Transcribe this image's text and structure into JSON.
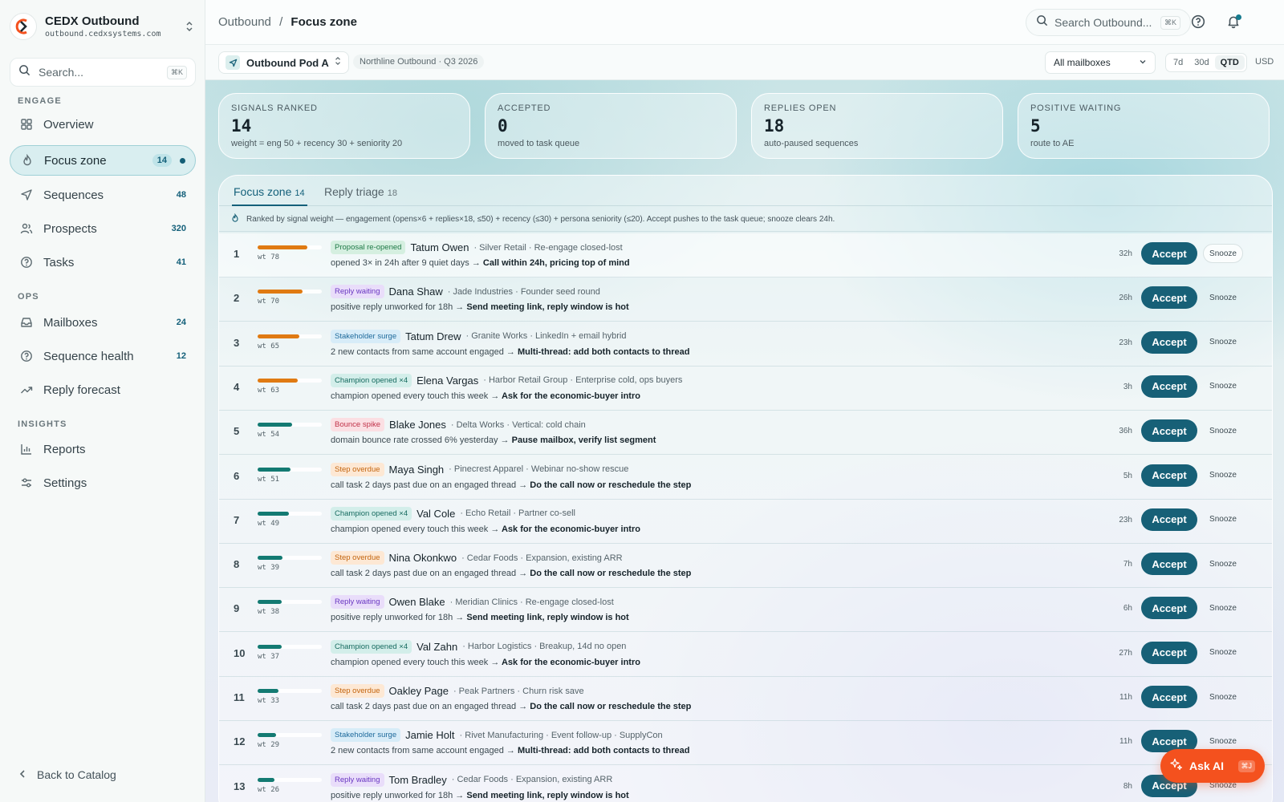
{
  "brand": {
    "name": "CEDX Outbound",
    "domain": "outbound.cedxsystems.com"
  },
  "sidebar": {
    "search_placeholder": "Search...",
    "search_kbd": "⌘K",
    "sections": {
      "engage": "ENGAGE",
      "ops": "OPS",
      "insights": "INSIGHTS"
    },
    "items": [
      {
        "label": "Overview",
        "count": "",
        "icon": "grid-icon"
      },
      {
        "label": "Focus zone",
        "count": "14",
        "icon": "flame-icon"
      },
      {
        "label": "Sequences",
        "count": "48",
        "icon": "send-icon"
      },
      {
        "label": "Prospects",
        "count": "320",
        "icon": "users-icon"
      },
      {
        "label": "Tasks",
        "count": "41",
        "icon": "help-circle-icon"
      },
      {
        "label": "Mailboxes",
        "count": "24",
        "icon": "inbox-icon"
      },
      {
        "label": "Sequence health",
        "count": "12",
        "icon": "help-circle-icon"
      },
      {
        "label": "Reply forecast",
        "count": "",
        "icon": "trending-up-icon"
      },
      {
        "label": "Reports",
        "count": "",
        "icon": "bar-chart-icon"
      },
      {
        "label": "Settings",
        "count": "",
        "icon": "sliders-icon"
      }
    ],
    "back": "Back to Catalog"
  },
  "topbar": {
    "crumb_root": "Outbound",
    "crumb_sep": "/",
    "crumb_current": "Focus zone",
    "search_placeholder": "Search Outbound...",
    "search_kbd": "⌘K"
  },
  "subbar": {
    "pod": "Outbound Pod A",
    "pod_meta": "Northline Outbound · Q3 2026",
    "mailbox": "All mailboxes",
    "ranges": [
      "7d",
      "30d",
      "QTD"
    ],
    "active_range": "QTD",
    "currency": "USD"
  },
  "stats": [
    {
      "label": "SIGNALS RANKED",
      "value": "14",
      "desc": "weight = eng 50 + recency 30 + seniority 20"
    },
    {
      "label": "ACCEPTED",
      "value": "0",
      "desc": "moved to task queue"
    },
    {
      "label": "REPLIES OPEN",
      "value": "18",
      "desc": "auto-paused sequences"
    },
    {
      "label": "POSITIVE WAITING",
      "value": "5",
      "desc": "route to AE"
    }
  ],
  "tabs": [
    {
      "label": "Focus zone",
      "count": "14"
    },
    {
      "label": "Reply triage",
      "count": "18"
    }
  ],
  "hint": "Ranked by signal weight — engagement (opens×6 + replies×18, ≤50) + recency (≤30) + persona seniority (≤20). Accept pushes to the task queue; snooze clears 24h.",
  "actions": {
    "accept": "Accept",
    "snooze": "Snooze"
  },
  "colors": {
    "accent": "#176077",
    "weight_high": "#e07a12",
    "weight_low": "#137a72",
    "ask_ai": "#f4511e"
  },
  "rows": [
    {
      "rank": "1",
      "weight": 78,
      "wt": "wt 78",
      "tag": "Proposal re-opened",
      "tag_color": "green",
      "person": "Tatum Owen",
      "meta": "· Silver Retail · Re-engage closed-lost",
      "signal": "opened 3× in 24h after 9 quiet days →",
      "action": " Call within 24h, pricing top of mind",
      "age": "32h"
    },
    {
      "rank": "2",
      "weight": 70,
      "wt": "wt 70",
      "tag": "Reply waiting",
      "tag_color": "purple",
      "person": "Dana Shaw",
      "meta": "· Jade Industries · Founder seed round",
      "signal": "positive reply unworked for 18h →",
      "action": " Send meeting link, reply window is hot",
      "age": "26h"
    },
    {
      "rank": "3",
      "weight": 65,
      "wt": "wt 65",
      "tag": "Stakeholder surge",
      "tag_color": "blue",
      "person": "Tatum Drew",
      "meta": "· Granite Works · LinkedIn + email hybrid",
      "signal": "2 new contacts from same account engaged →",
      "action": " Multi-thread: add both contacts to thread",
      "age": "23h"
    },
    {
      "rank": "4",
      "weight": 63,
      "wt": "wt 63",
      "tag": "Champion opened ×4",
      "tag_color": "teal",
      "person": "Elena Vargas",
      "meta": "· Harbor Retail Group · Enterprise cold, ops buyers",
      "signal": "champion opened every touch this week →",
      "action": " Ask for the economic-buyer intro",
      "age": "3h"
    },
    {
      "rank": "5",
      "weight": 54,
      "wt": "wt 54",
      "tag": "Bounce spike",
      "tag_color": "red",
      "person": "Blake Jones",
      "meta": "· Delta Works · Vertical: cold chain",
      "signal": "domain bounce rate crossed 6% yesterday →",
      "action": " Pause mailbox, verify list segment",
      "age": "36h"
    },
    {
      "rank": "6",
      "weight": 51,
      "wt": "wt 51",
      "tag": "Step overdue",
      "tag_color": "orange",
      "person": "Maya Singh",
      "meta": "· Pinecrest Apparel · Webinar no-show rescue",
      "signal": "call task 2 days past due on an engaged thread →",
      "action": " Do the call now or reschedule the step",
      "age": "5h"
    },
    {
      "rank": "7",
      "weight": 49,
      "wt": "wt 49",
      "tag": "Champion opened ×4",
      "tag_color": "teal",
      "person": "Val Cole",
      "meta": "· Echo Retail · Partner co-sell",
      "signal": "champion opened every touch this week →",
      "action": " Ask for the economic-buyer intro",
      "age": "23h"
    },
    {
      "rank": "8",
      "weight": 39,
      "wt": "wt 39",
      "tag": "Step overdue",
      "tag_color": "orange",
      "person": "Nina Okonkwo",
      "meta": "· Cedar Foods · Expansion, existing ARR",
      "signal": "call task 2 days past due on an engaged thread →",
      "action": " Do the call now or reschedule the step",
      "age": "7h"
    },
    {
      "rank": "9",
      "weight": 38,
      "wt": "wt 38",
      "tag": "Reply waiting",
      "tag_color": "purple",
      "person": "Owen Blake",
      "meta": "· Meridian Clinics · Re-engage closed-lost",
      "signal": "positive reply unworked for 18h →",
      "action": " Send meeting link, reply window is hot",
      "age": "6h"
    },
    {
      "rank": "10",
      "weight": 37,
      "wt": "wt 37",
      "tag": "Champion opened ×4",
      "tag_color": "teal",
      "person": "Val Zahn",
      "meta": "· Harbor Logistics · Breakup, 14d no open",
      "signal": "champion opened every touch this week →",
      "action": " Ask for the economic-buyer intro",
      "age": "27h"
    },
    {
      "rank": "11",
      "weight": 33,
      "wt": "wt 33",
      "tag": "Step overdue",
      "tag_color": "orange",
      "person": "Oakley Page",
      "meta": "· Peak Partners · Churn risk save",
      "signal": "call task 2 days past due on an engaged thread →",
      "action": " Do the call now or reschedule the step",
      "age": "11h"
    },
    {
      "rank": "12",
      "weight": 29,
      "wt": "wt 29",
      "tag": "Stakeholder surge",
      "tag_color": "blue",
      "person": "Jamie Holt",
      "meta": "· Rivet Manufacturing · Event follow-up · SupplyCon",
      "signal": "2 new contacts from same account engaged →",
      "action": " Multi-thread: add both contacts to thread",
      "age": "11h"
    },
    {
      "rank": "13",
      "weight": 26,
      "wt": "wt 26",
      "tag": "Reply waiting",
      "tag_color": "purple",
      "person": "Tom Bradley",
      "meta": "· Cedar Foods · Expansion, existing ARR",
      "signal": "positive reply unworked for 18h →",
      "action": " Send meeting link, reply window is hot",
      "age": "8h"
    }
  ],
  "ask_ai": {
    "label": "Ask AI",
    "kbd": "⌘J"
  }
}
